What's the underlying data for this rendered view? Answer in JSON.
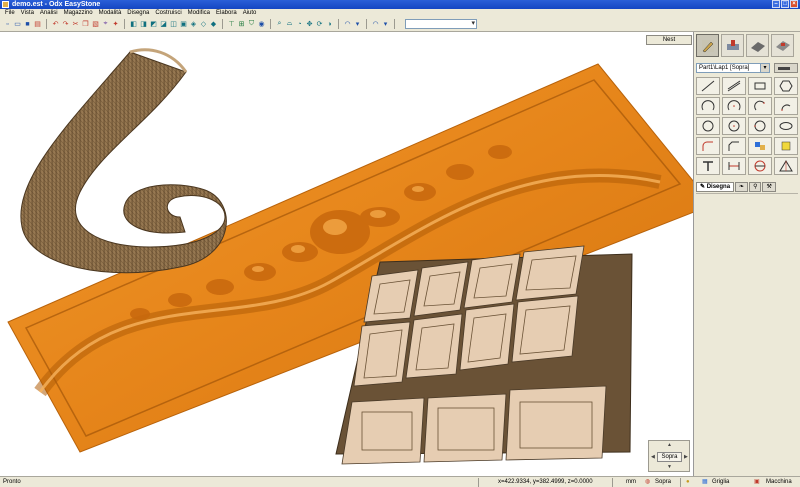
{
  "window": {
    "title": "demo.est - Odx EasyStone"
  },
  "menu": [
    "File",
    "Vista",
    "Analisi",
    "Magazzino",
    "Modalità",
    "Disegna",
    "Costruisci",
    "Modifica",
    "Elabora",
    "Aiuto"
  ],
  "toolbar": {
    "icons": [
      "new-icon",
      "open-icon",
      "save-icon",
      "print-icon",
      "undo-icon",
      "redo-icon",
      "cut-icon",
      "copy-icon",
      "paste-icon",
      "measure-icon",
      "zoom-icon",
      "view-icon"
    ],
    "combo_value": ""
  },
  "canvas": {
    "nest_label": "Nest",
    "colors": {
      "panel": "#e88a1e",
      "panel_shade": "#c26a0c",
      "wood": "#8a6d48",
      "tile": "#e6cdb2",
      "slab": "#6a5236"
    }
  },
  "right_panel": {
    "part_select": "Part1\\Lap1 [Sopra]",
    "tabs": {
      "disegna": "Disegna"
    }
  },
  "navpad": {
    "view_label": "Sopra"
  },
  "status": {
    "ready": "Pronto",
    "coords": "x=422.9334, y=382.4999, z=0.0000",
    "unit": "mm",
    "view": "Sopra",
    "grid": "Griglia",
    "machine": "Macchina"
  }
}
